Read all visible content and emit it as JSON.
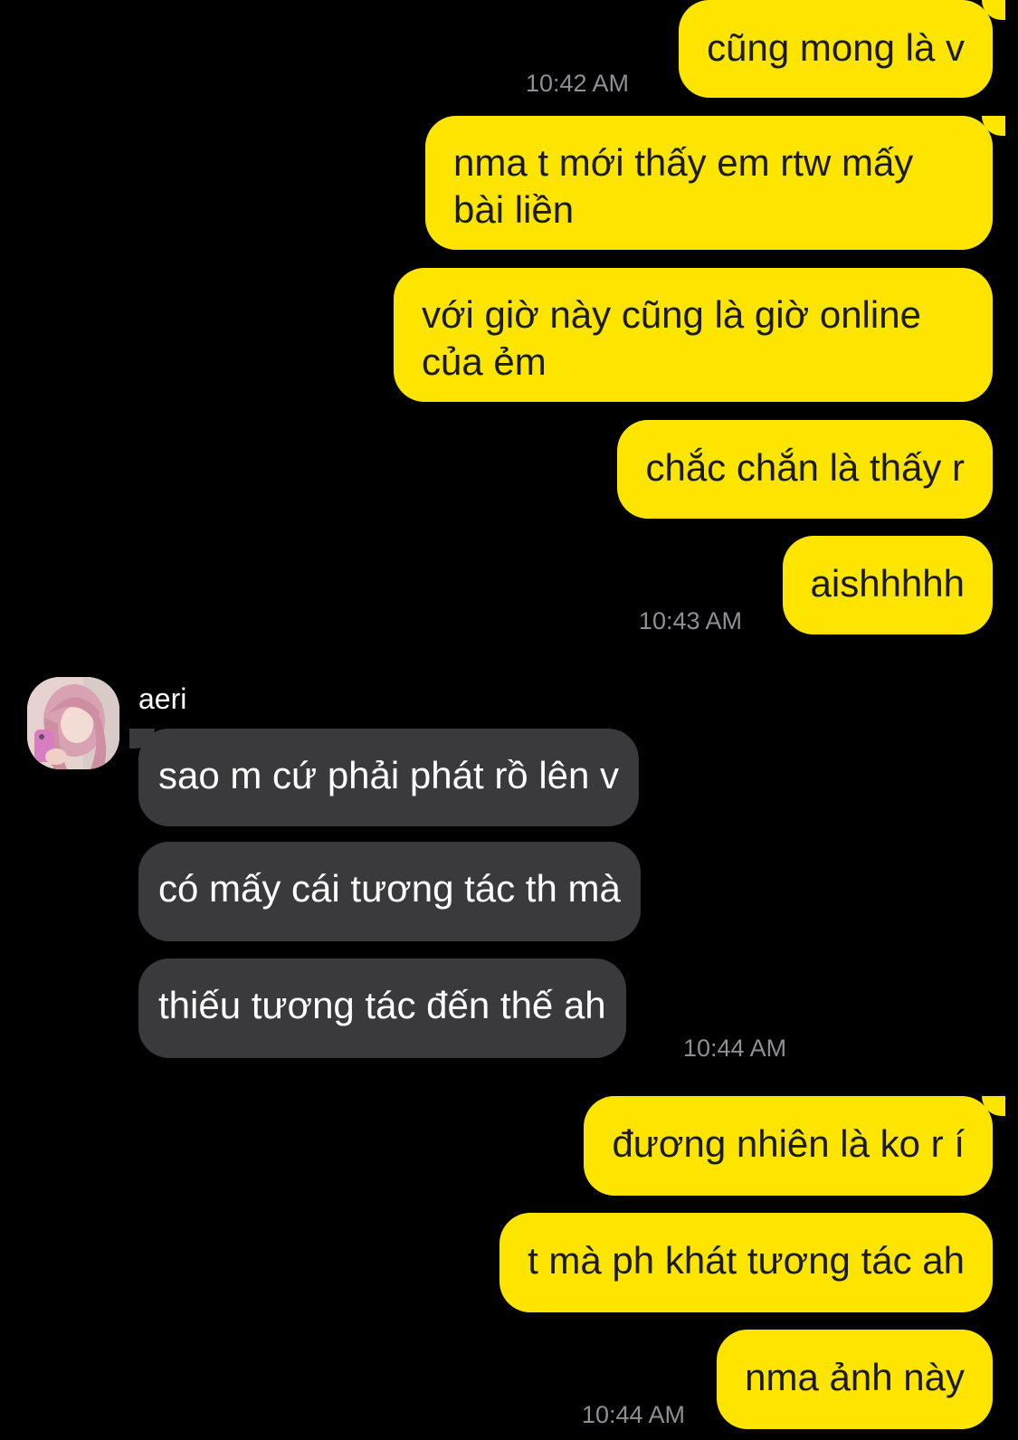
{
  "messages": [
    {
      "side": "out",
      "text": "cũng mong là v",
      "time": "10:42 AM"
    },
    {
      "side": "out",
      "text": "nma t mới thấy em rtw mấy bài liền"
    },
    {
      "side": "out",
      "text": "với giờ này cũng là giờ online của ẻm"
    },
    {
      "side": "out",
      "text": "chắc chắn là thấy r"
    },
    {
      "side": "out",
      "text": "aishhhhh",
      "time": "10:43 AM"
    },
    {
      "side": "in",
      "sender": "aeri",
      "text": "sao m cứ phải phát rồ lên v"
    },
    {
      "side": "in",
      "text": "có mấy cái tương tác th mà"
    },
    {
      "side": "in",
      "text": "thiếu tương tác đến thế ah",
      "time": "10:44 AM"
    },
    {
      "side": "out",
      "text": "đương nhiên là ko r í"
    },
    {
      "side": "out",
      "text": "t mà ph khát tương tác ah"
    },
    {
      "side": "out",
      "text": "nma ảnh này",
      "time": "10:44 AM"
    }
  ],
  "colors": {
    "background": "#000000",
    "outgoing_bubble": "#fee500",
    "incoming_bubble": "#3a3a3c",
    "timestamp": "#8e8e93"
  },
  "icons": {
    "avatar": "profile-photo-avatar"
  }
}
